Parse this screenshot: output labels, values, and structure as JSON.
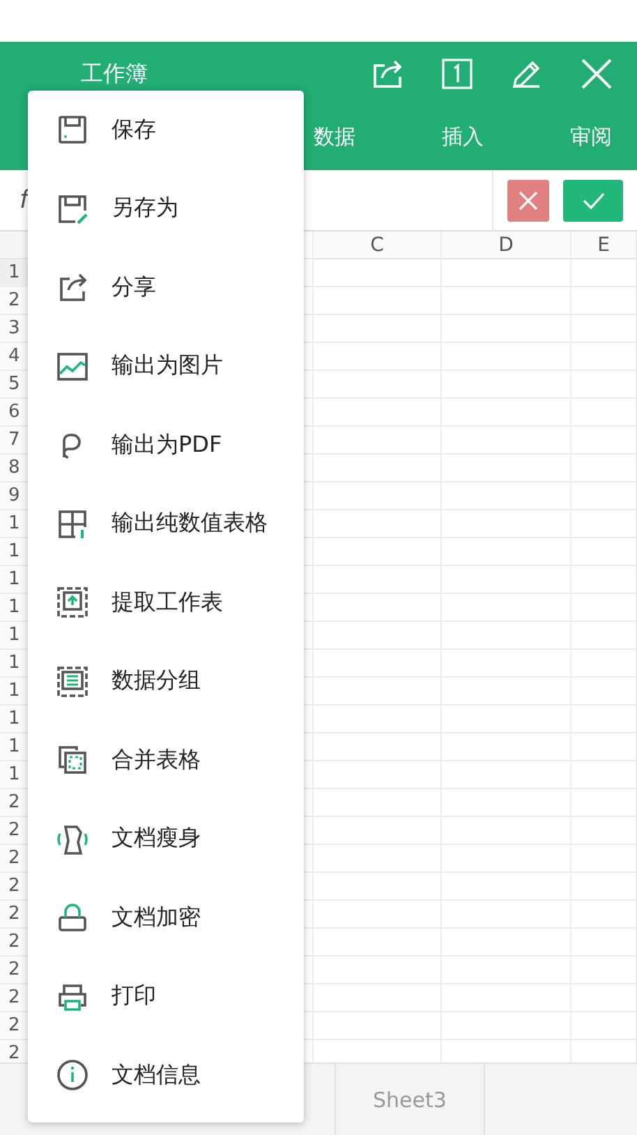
{
  "header": {
    "title": "工作簿",
    "tabs": [
      {
        "label": "数据",
        "selected": false
      },
      {
        "label": "插入",
        "selected": false
      },
      {
        "label": "审阅",
        "selected": false
      }
    ]
  },
  "formula_bar": {
    "label": "f"
  },
  "sheet": {
    "columns": [
      "C",
      "D",
      "E"
    ],
    "rows": [
      "1",
      "2",
      "3",
      "4",
      "5",
      "6",
      "7",
      "8",
      "9",
      "1",
      "1",
      "1",
      "1",
      "1",
      "1",
      "1",
      "1",
      "1",
      "1",
      "2",
      "2",
      "2",
      "2",
      "2",
      "2",
      "2",
      "2",
      "2",
      "2"
    ]
  },
  "sheet_tabs": [
    {
      "label": "Sheet3",
      "selected": false
    }
  ],
  "menu": [
    {
      "label": "保存"
    },
    {
      "label": "另存为"
    },
    {
      "label": "分享"
    },
    {
      "label": "输出为图片"
    },
    {
      "label": "输出为PDF"
    },
    {
      "label": "输出纯数值表格"
    },
    {
      "label": "提取工作表"
    },
    {
      "label": "数据分组"
    },
    {
      "label": "合并表格"
    },
    {
      "label": "文档瘦身"
    },
    {
      "label": "文档加密"
    },
    {
      "label": "打印"
    },
    {
      "label": "文档信息"
    }
  ]
}
